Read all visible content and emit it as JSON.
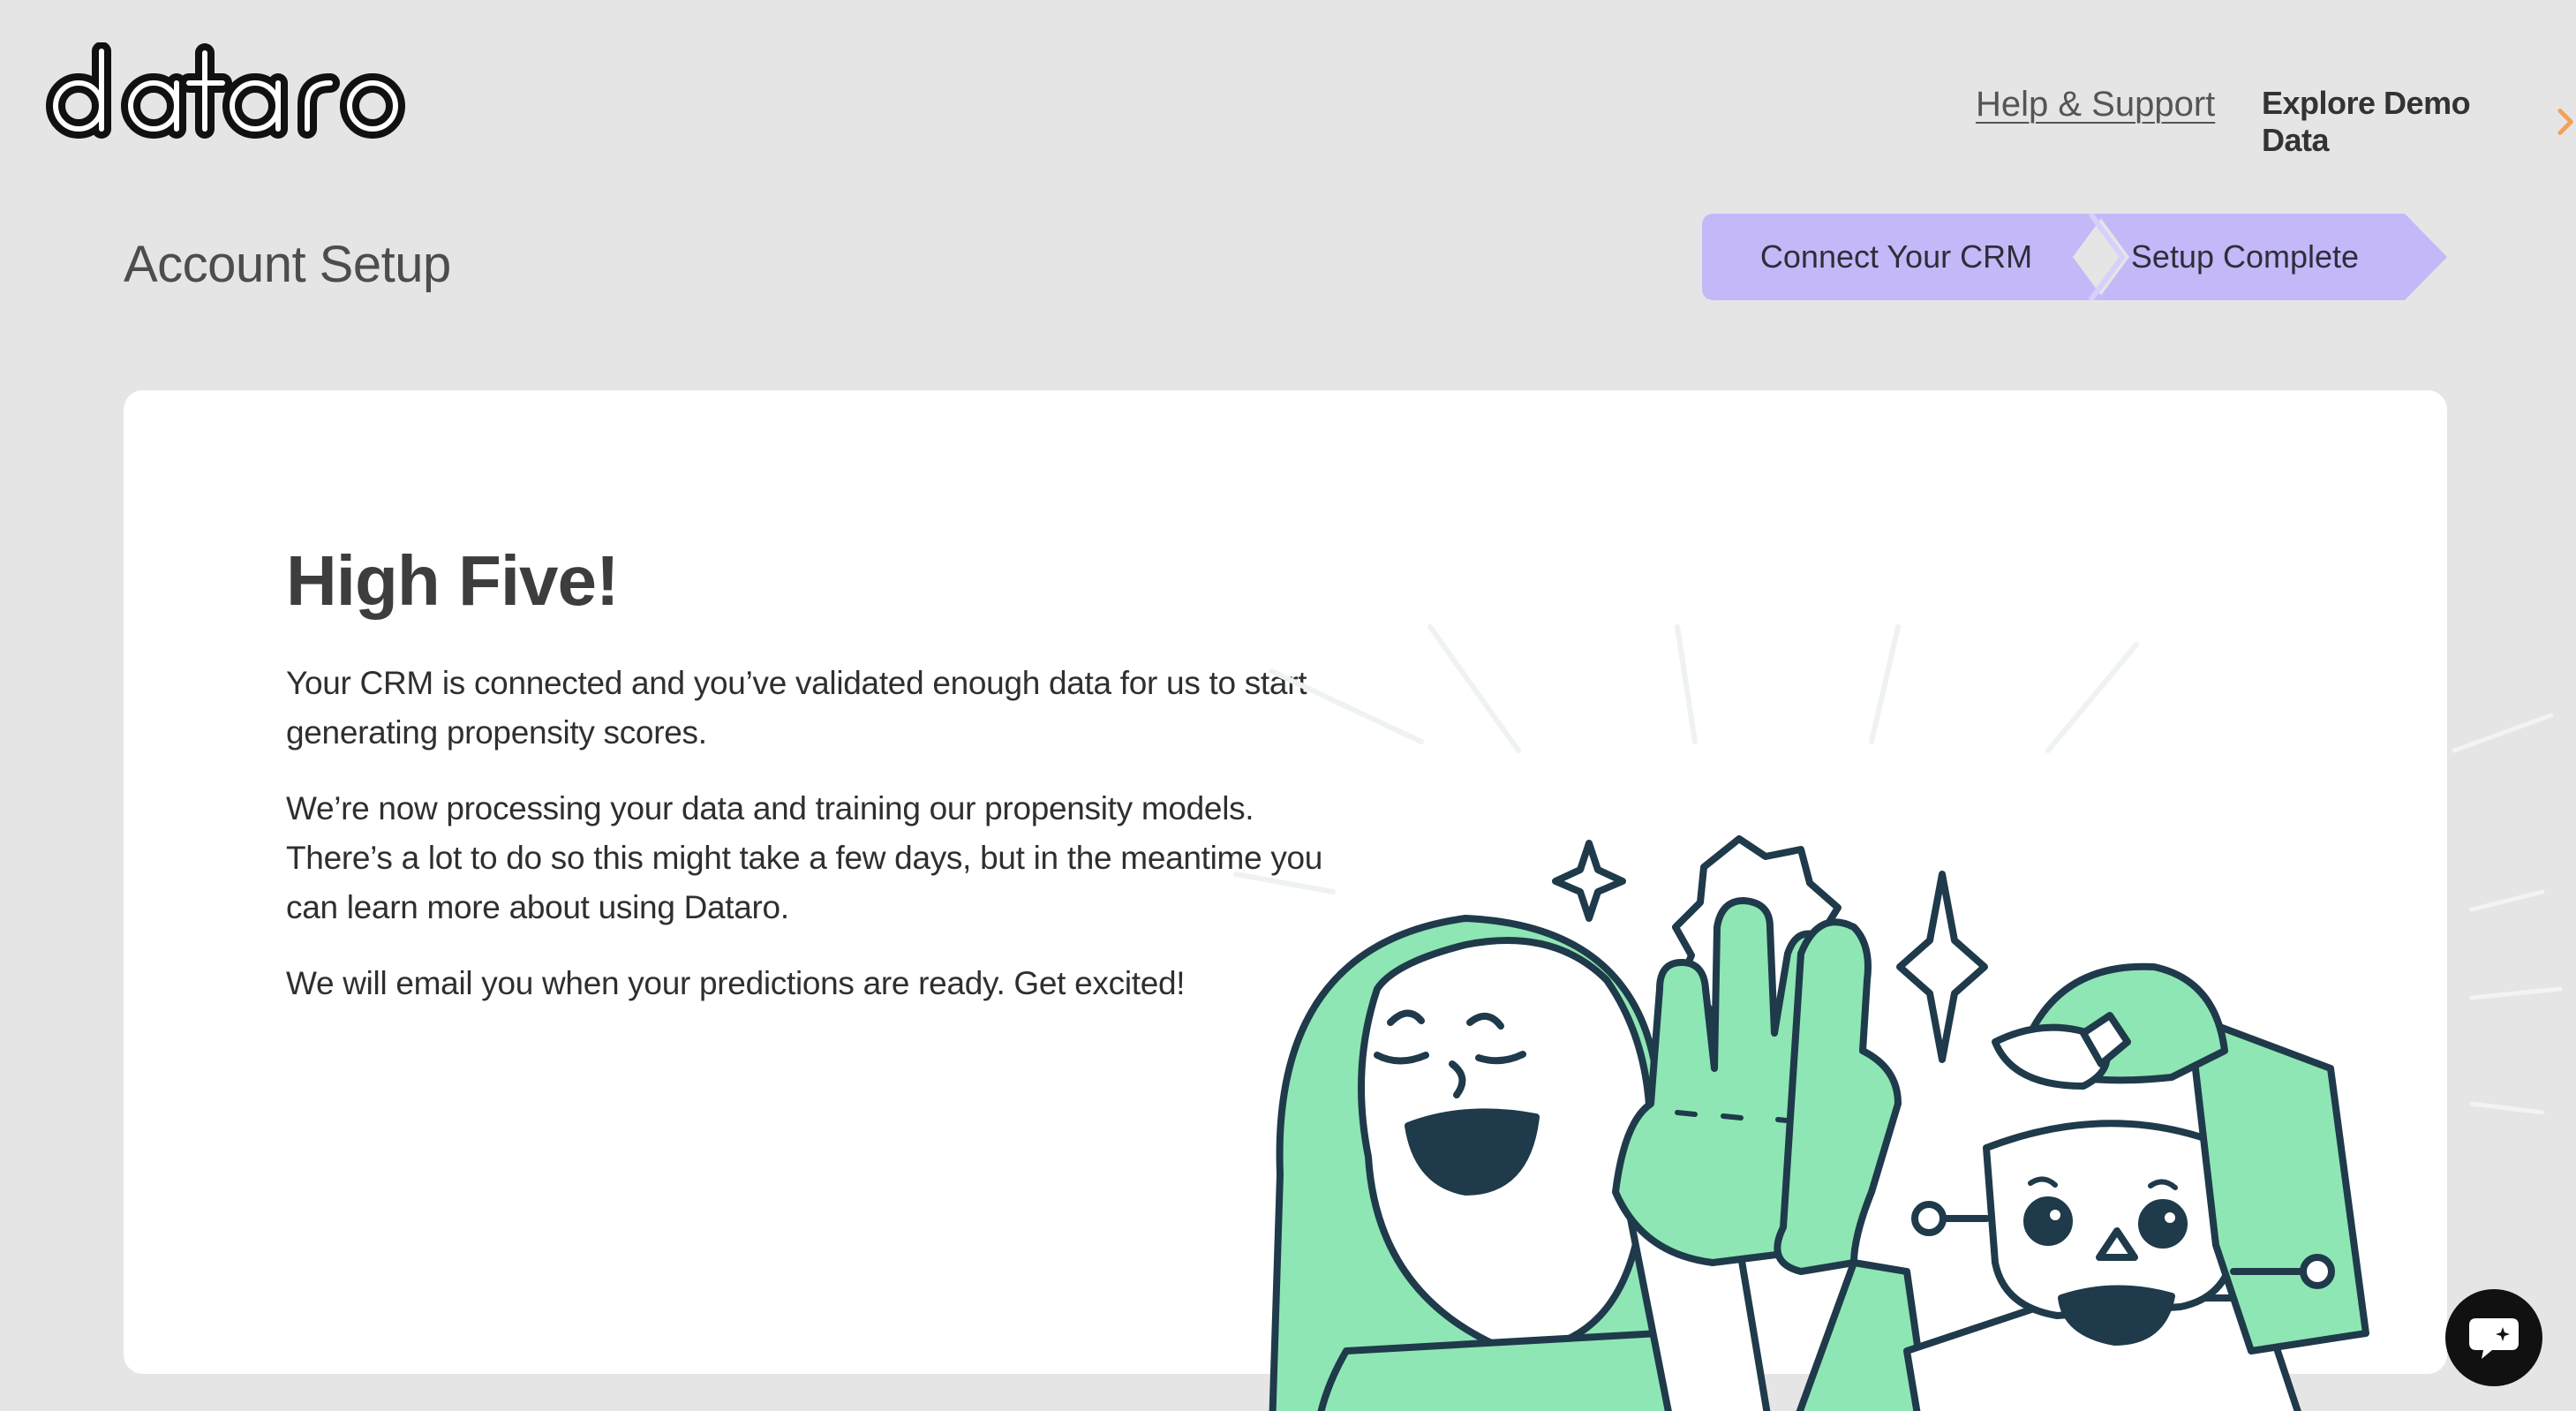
{
  "header": {
    "logo_text": "dataro",
    "help_link": "Help & Support",
    "demo_link": "Explore Demo Data"
  },
  "page": {
    "title": "Account Setup"
  },
  "stepper": {
    "steps": [
      {
        "label": "Connect Your CRM"
      },
      {
        "label": "Setup Complete"
      }
    ]
  },
  "card": {
    "headline": "High Five!",
    "paragraphs": [
      "Your CRM is connected and you’ve validated enough data for us to start generating propensity scores.",
      "We’re now processing your data and training our propensity models. There’s a lot to do so this might take a few days, but in the meantime you can learn more about using Dataro.",
      "We will email you when your predictions are ready. Get excited!"
    ]
  },
  "colors": {
    "background": "#e5e5e5",
    "stepper": "#c4b8f8",
    "accent_orange": "#f5a05a",
    "illustration_green": "#8ee6b4",
    "illustration_outline": "#1f3a4a"
  },
  "icons": {
    "demo_arrow": "chevron-right-icon",
    "chat": "chat-icon"
  }
}
